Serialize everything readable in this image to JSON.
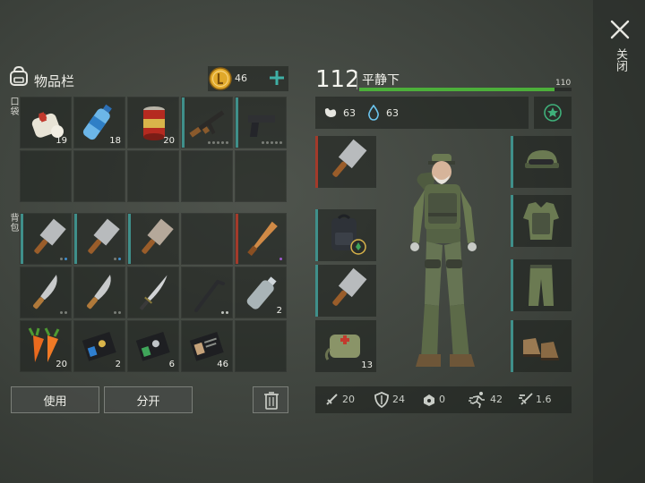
{
  "header": {
    "close_label": "关闭",
    "inventory_title": "物品栏",
    "coins": "46",
    "pockets_label": "口袋",
    "backpack_label": "背包"
  },
  "inventory": {
    "pocket_row1": [
      {
        "icon": "bandage-icon",
        "qty": "19"
      },
      {
        "icon": "water-bottle-icon",
        "qty": "18"
      },
      {
        "icon": "canned-food-icon",
        "qty": "20"
      },
      {
        "icon": "assault-rifle-icon",
        "qty": ""
      },
      {
        "icon": "pistol-icon",
        "qty": ""
      }
    ],
    "backpack_row1": [
      {
        "icon": "cleaver-icon",
        "qty": ""
      },
      {
        "icon": "cleaver-icon",
        "qty": ""
      },
      {
        "icon": "cleaver-icon",
        "qty": ""
      },
      {
        "icon": "empty",
        "qty": ""
      },
      {
        "icon": "baseball-bat-icon",
        "qty": ""
      }
    ],
    "backpack_row2": [
      {
        "icon": "machete-icon",
        "qty": ""
      },
      {
        "icon": "machete-icon",
        "qty": ""
      },
      {
        "icon": "katana-icon",
        "qty": ""
      },
      {
        "icon": "crowbar-icon",
        "qty": ""
      },
      {
        "icon": "plastic-bottle-icon",
        "qty": "2"
      }
    ],
    "backpack_row3": [
      {
        "icon": "carrot-icon",
        "qty": "20"
      },
      {
        "icon": "blue-card-icon",
        "qty": "2"
      },
      {
        "icon": "green-card-icon",
        "qty": "6"
      },
      {
        "icon": "id-card-icon",
        "qty": "46"
      },
      {
        "icon": "empty",
        "qty": ""
      }
    ]
  },
  "buttons": {
    "use": "使用",
    "split": "分开"
  },
  "character": {
    "level": "112",
    "mood": "平静下",
    "xp_max": "110",
    "xp_fraction": 0.92,
    "hunger": "63",
    "thirst": "63",
    "equipment_left": [
      {
        "icon": "cleaver-icon",
        "qty": ""
      },
      {
        "icon": "backpack-icon",
        "qty": ""
      },
      {
        "icon": "cleaver-icon",
        "qty": ""
      },
      {
        "icon": "medkit-icon",
        "qty": "13"
      }
    ],
    "equipment_right": [
      {
        "icon": "camo-cap-icon"
      },
      {
        "icon": "camo-vest-icon"
      },
      {
        "icon": "camo-pants-icon"
      },
      {
        "icon": "boots-icon"
      }
    ],
    "combat_stats": {
      "attack": "20",
      "defense": "24",
      "radiation": "0",
      "speed": "42",
      "attack_speed": "1.6"
    }
  },
  "colors": {
    "accent_teal": "#3f8f8a",
    "xp_green": "#4caf3a",
    "coin_gold": "#e0a82a"
  }
}
